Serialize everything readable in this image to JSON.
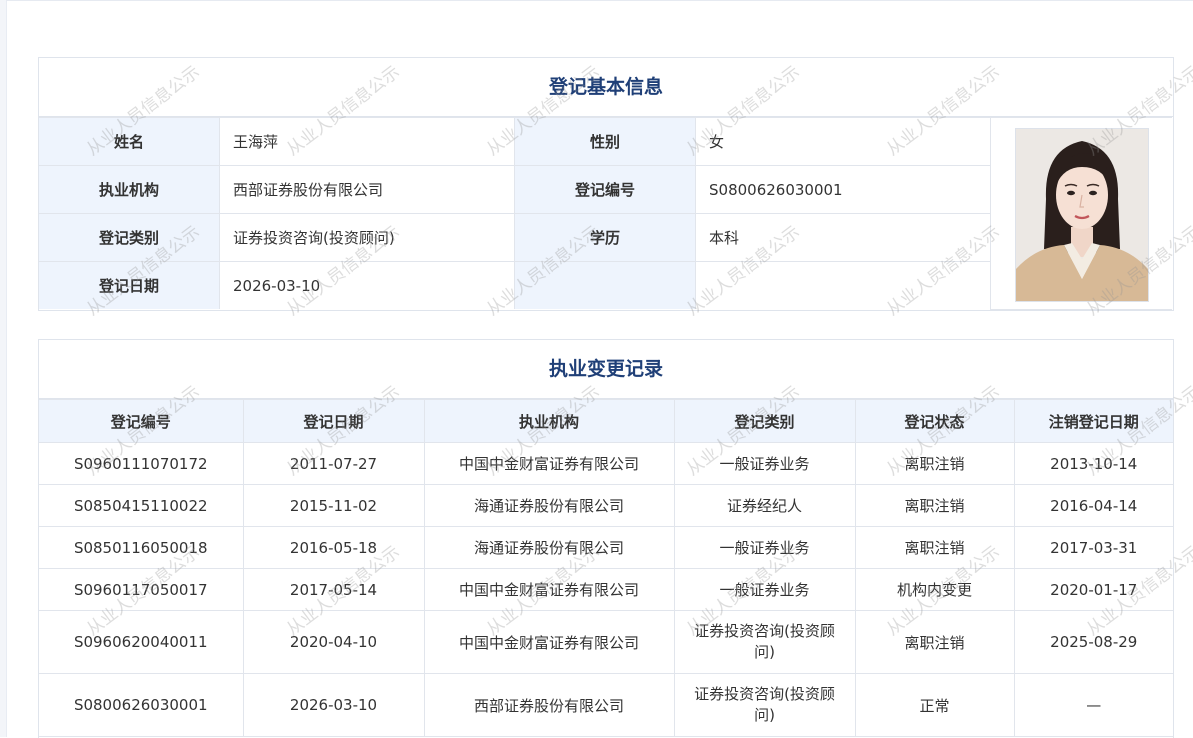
{
  "basic": {
    "title": "登记基本信息",
    "rows": [
      {
        "label1": "姓名",
        "value1": "王海萍",
        "label2": "性别",
        "value2": "女"
      },
      {
        "label1": "执业机构",
        "value1": "西部证券股份有限公司",
        "label2": "登记编号",
        "value2": "S0800626030001"
      },
      {
        "label1": "登记类别",
        "value1": "证券投资咨询(投资顾问)",
        "label2": "学历",
        "value2": "本科"
      },
      {
        "label1": "登记日期",
        "value1": "2026-03-10",
        "label2": "",
        "value2": ""
      }
    ]
  },
  "history": {
    "title": "执业变更记录",
    "headers": [
      "登记编号",
      "登记日期",
      "执业机构",
      "登记类别",
      "登记状态",
      "注销登记日期"
    ],
    "rows": [
      [
        "S0960111070172",
        "2011-07-27",
        "中国中金财富证券有限公司",
        "一般证券业务",
        "离职注销",
        "2013-10-14"
      ],
      [
        "S0850415110022",
        "2015-11-02",
        "海通证券股份有限公司",
        "证券经纪人",
        "离职注销",
        "2016-04-14"
      ],
      [
        "S0850116050018",
        "2016-05-18",
        "海通证券股份有限公司",
        "一般证券业务",
        "离职注销",
        "2017-03-31"
      ],
      [
        "S0960117050017",
        "2017-05-14",
        "中国中金财富证券有限公司",
        "一般证券业务",
        "机构内变更",
        "2020-01-17"
      ],
      [
        "S0960620040011",
        "2020-04-10",
        "中国中金财富证券有限公司",
        "证券投资咨询(投资顾问)",
        "离职注销",
        "2025-08-29"
      ],
      [
        "S0800626030001",
        "2026-03-10",
        "西部证券股份有限公司",
        "证券投资咨询(投资顾问)",
        "正常",
        "—"
      ]
    ]
  },
  "watermark": {
    "text": "从业人员信息公示"
  },
  "colors": {
    "title": "#1f3f77",
    "label_bg": "#eef4fd",
    "border": "#e1e5ec"
  }
}
